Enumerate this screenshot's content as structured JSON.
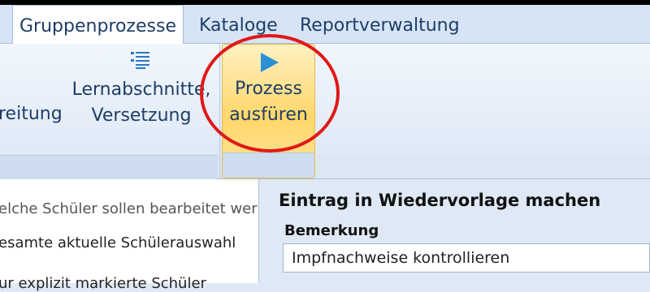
{
  "tabs": [
    {
      "label": "Gruppenprozesse",
      "active": true
    },
    {
      "label": "Kataloge",
      "active": false
    },
    {
      "label": "Reportverwaltung",
      "active": false
    }
  ],
  "ribbon": {
    "partial_button_label": "reitung",
    "lernabschnitte_line1": "Lernabschnitte,",
    "lernabschnitte_line2": "Versetzung",
    "run_line1": "Prozess",
    "run_line2": "ausfüren",
    "icons": [
      "list-icon",
      "play-icon"
    ]
  },
  "left_panel": {
    "question": "elche Schüler sollen bearbeitet wer",
    "option1": "esamte aktuelle Schülerauswahl",
    "option2": "ur explizit markierte Schüler"
  },
  "right_panel": {
    "title": "Eintrag in Wiedervorlage machen",
    "bemerkung_label": "Bemerkung",
    "bemerkung_value": "Impfnachweise kontrollieren"
  },
  "colors": {
    "accent": "#1f3d66",
    "highlight": "#ffd76a",
    "annotation": "#e01818"
  }
}
